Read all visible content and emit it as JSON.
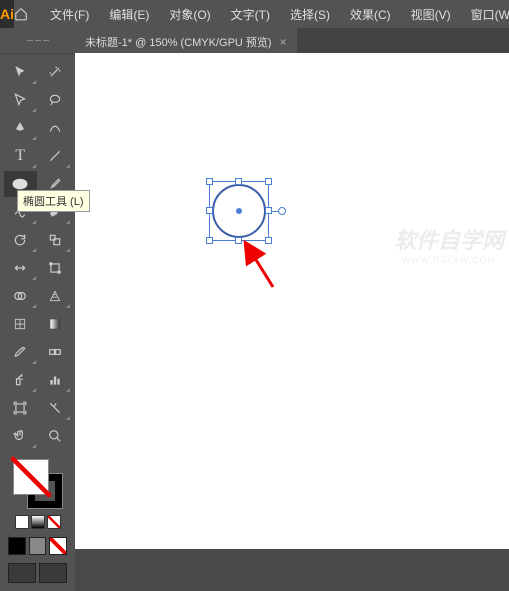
{
  "app": {
    "logo": "Ai"
  },
  "menu": {
    "items": [
      "文件(F)",
      "编辑(E)",
      "对象(O)",
      "文字(T)",
      "选择(S)",
      "效果(C)",
      "视图(V)",
      "窗口(W"
    ]
  },
  "tab": {
    "title": "未标题-1* @ 150% (CMYK/GPU 预览)",
    "close": "×"
  },
  "tooltip": {
    "text": "椭圆工具 (L)"
  },
  "watermark": {
    "main": "软件自学网",
    "sub": "WWW.RJZXW.COM"
  }
}
